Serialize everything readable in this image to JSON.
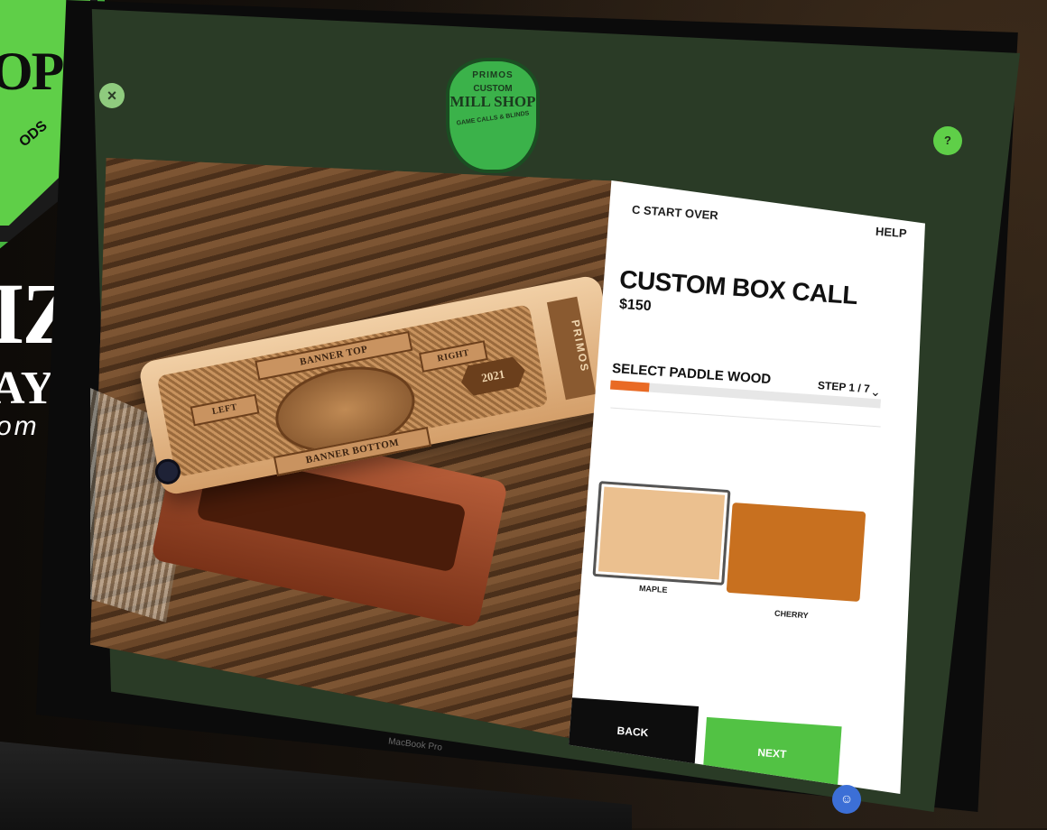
{
  "header": {
    "close_icon": "×",
    "help_icon": "?",
    "logo": {
      "brand": "PRIMOS",
      "line1": "CUSTOM",
      "line2": "MILL SHOP",
      "subtitle": "GAME CALLS & BLINDS"
    }
  },
  "side_promo": {
    "shield_text": "OP",
    "shield_sub": "ODS",
    "headline": "IZE",
    "subheadline": "AY",
    "url_fragment": "om"
  },
  "product_image": {
    "ribbon_top": "BANNER TOP",
    "ribbon_bottom": "BANNER BOTTOM",
    "ribbon_left": "LEFT",
    "ribbon_right": "RIGHT",
    "badge": "2021",
    "brand_strip": "PRIMOS"
  },
  "panel": {
    "start_over_label": "C START OVER",
    "help_label": "HELP",
    "title": "CUSTOM BOX CALL",
    "price": "$150",
    "step_label": "SELECT PADDLE WOOD",
    "step_indicator": "STEP 1 / 7",
    "step_chevron": "⌄",
    "progress_fraction": 0.143,
    "options": [
      {
        "name": "MAPLE",
        "color": "#EBC08F",
        "selected": true
      },
      {
        "name": "CHERRY",
        "color": "#C8701F",
        "selected": false
      }
    ],
    "back_label": "BACK",
    "next_label": "NEXT"
  },
  "laptop": {
    "brand_label": "MacBook Pro"
  },
  "colors": {
    "screen_bg": "#2A3B26",
    "accent_green": "#52C244",
    "progress_orange": "#E96A24"
  }
}
